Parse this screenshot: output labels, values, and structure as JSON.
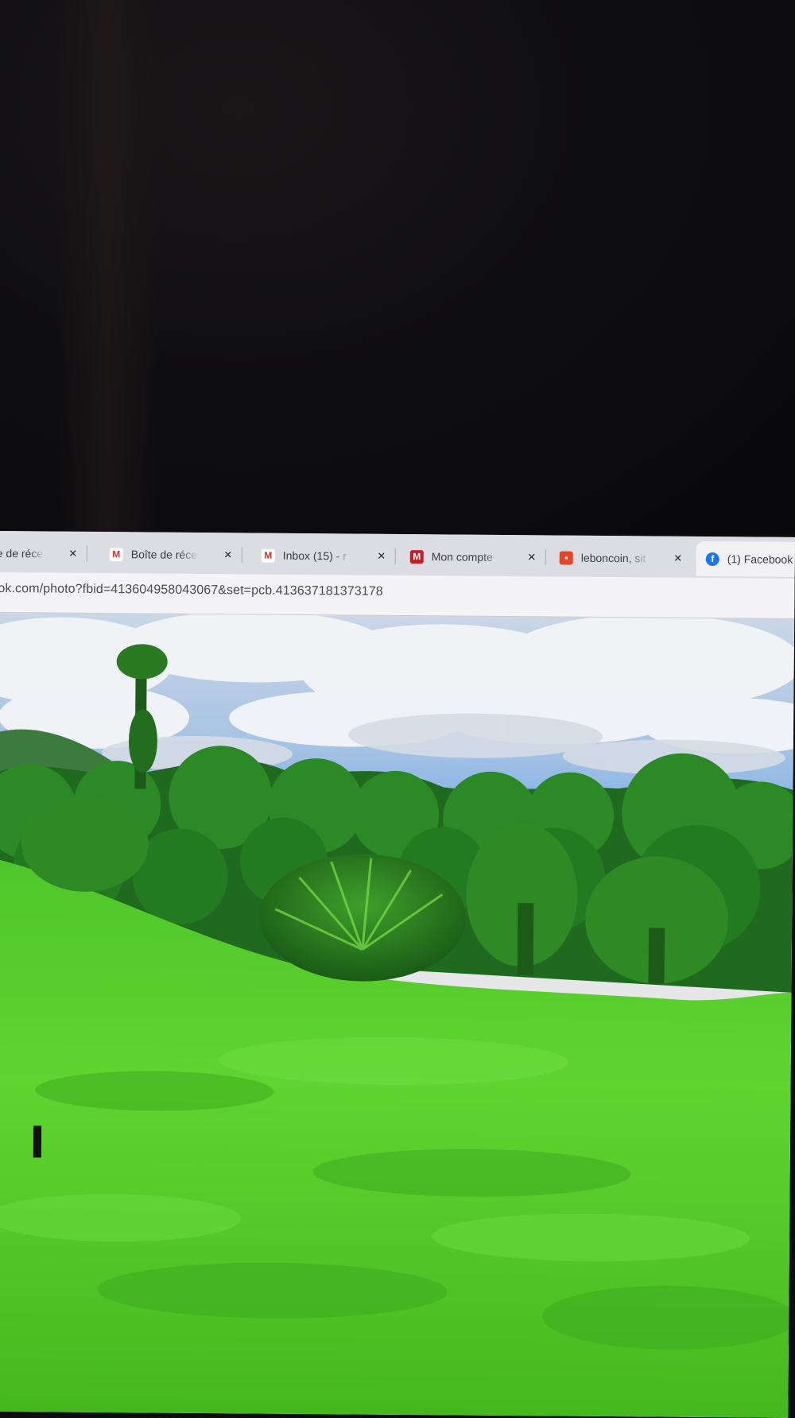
{
  "browser": {
    "tabs": [
      {
        "label": "e de réce",
        "icon": "gmail-icon",
        "active": false
      },
      {
        "label": "Boîte de réce",
        "icon": "gmail-icon",
        "active": false
      },
      {
        "label": "Inbox (15) - r",
        "icon": "gmail-icon",
        "active": false
      },
      {
        "label": "Mon compte",
        "icon": "mon-compte-icon",
        "active": false
      },
      {
        "label": "leboncoin, sit",
        "icon": "leboncoin-icon",
        "active": false
      },
      {
        "label": "(1) Facebook",
        "icon": "facebook-icon",
        "active": true
      }
    ],
    "close_glyph": "×",
    "url": "ok.com/photo?fbid=413604958043067&set=pcb.413637181373178"
  },
  "photo": {
    "subject": "tropical hillside with grass, banana plants and forest under a cloudy sky"
  }
}
